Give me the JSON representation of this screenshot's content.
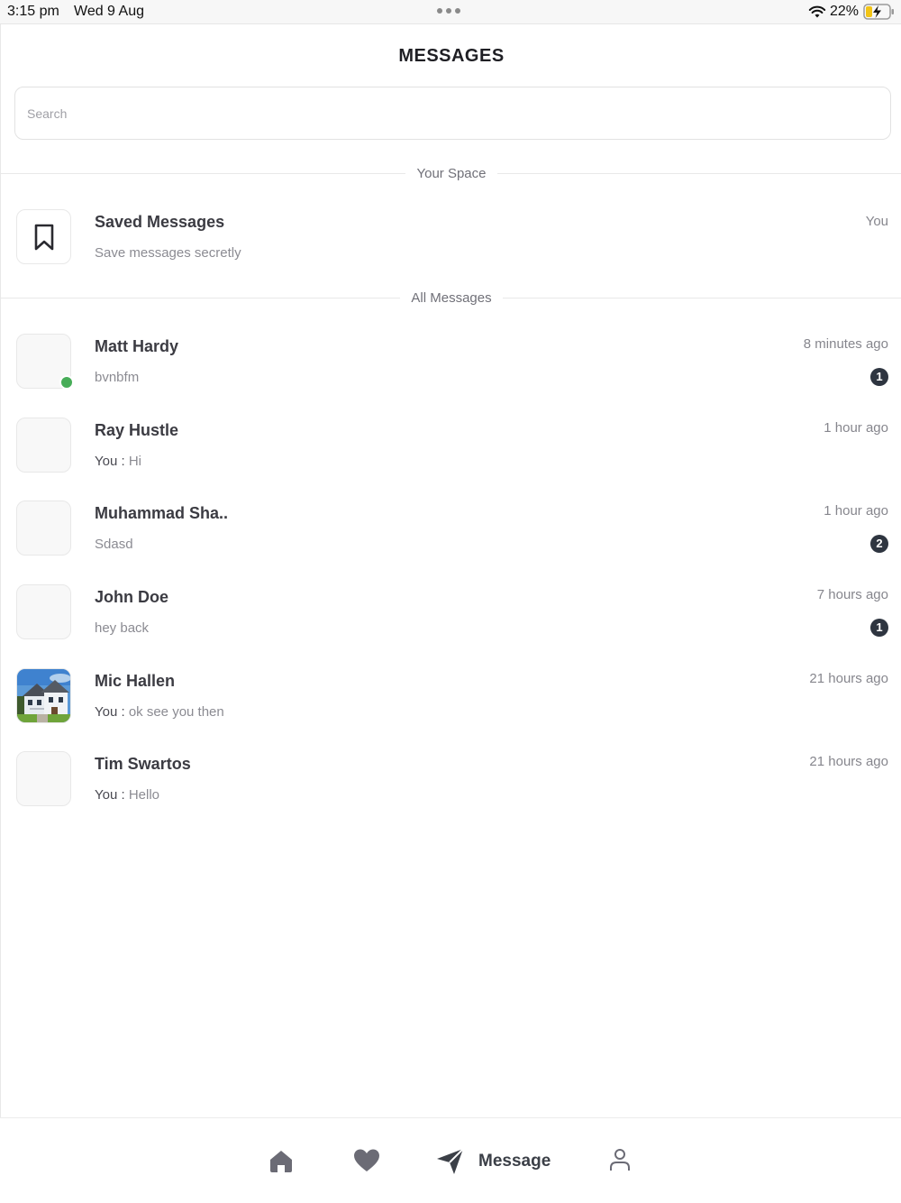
{
  "status_bar": {
    "time": "3:15 pm",
    "date": "Wed 9 Aug",
    "battery": "22%"
  },
  "header": {
    "title": "MESSAGES"
  },
  "search": {
    "placeholder": "Search"
  },
  "sections": {
    "your_space": "Your Space",
    "all_messages": "All Messages"
  },
  "saved": {
    "title": "Saved Messages",
    "subtitle": "Save messages secretly",
    "meta": "You",
    "icon": "bookmark-icon"
  },
  "conversations": [
    {
      "name": "Matt Hardy",
      "you_prefix": "",
      "preview": "bvnbfm",
      "time": "8 minutes ago",
      "unread": "1",
      "online": true
    },
    {
      "name": "Ray Hustle",
      "you_prefix": "You : ",
      "preview": "Hi",
      "time": "1 hour ago",
      "unread": "",
      "online": false
    },
    {
      "name": "Muhammad Sha..",
      "you_prefix": "",
      "preview": "Sdasd",
      "time": "1 hour ago",
      "unread": "2",
      "online": false
    },
    {
      "name": "John Doe",
      "you_prefix": "",
      "preview": "hey back",
      "time": "7 hours ago",
      "unread": "1",
      "online": false
    },
    {
      "name": "Mic Hallen",
      "you_prefix": "You : ",
      "preview": "ok see you then",
      "time": "21 hours ago",
      "unread": "",
      "online": false,
      "avatar": "house-photo"
    },
    {
      "name": "Tim Swartos",
      "you_prefix": "You : ",
      "preview": "Hello",
      "time": "21 hours ago",
      "unread": "",
      "online": false
    }
  ],
  "tabbar": {
    "items": [
      {
        "icon": "home-icon"
      },
      {
        "icon": "heart-icon"
      },
      {
        "icon": "send-icon",
        "label": "Message",
        "active": true
      },
      {
        "icon": "user-icon"
      }
    ]
  },
  "colors": {
    "online": "#47ad58",
    "badge": "#2e3540",
    "text_primary": "#3b3b42",
    "text_secondary": "#8b8b92"
  }
}
